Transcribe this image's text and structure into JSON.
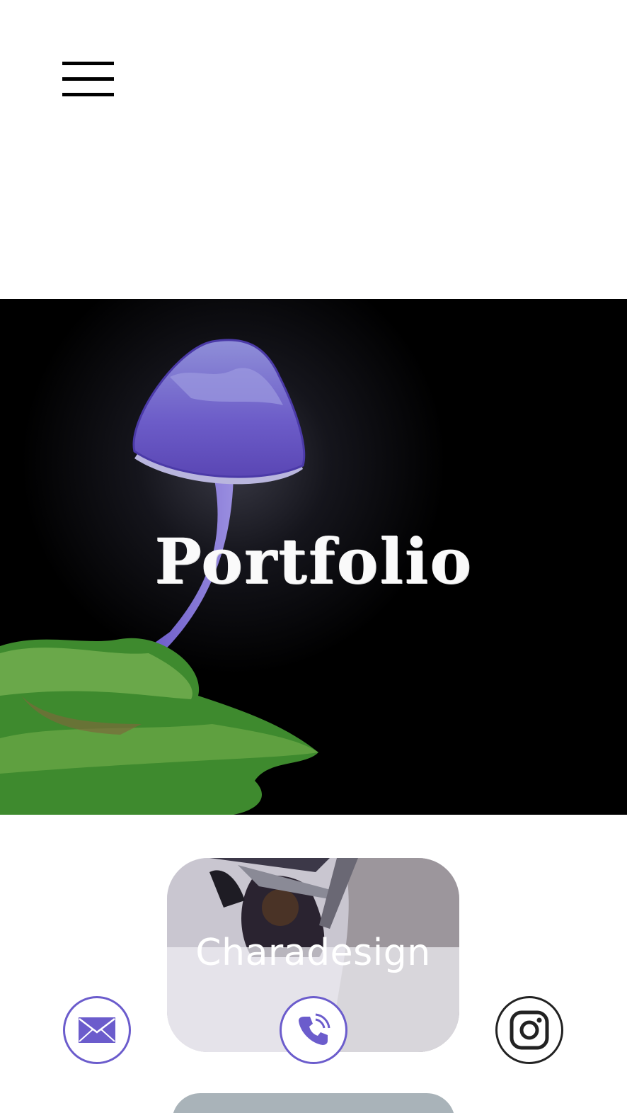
{
  "header": {
    "menu_icon": "hamburger-menu-icon"
  },
  "hero": {
    "title": "Portfolio",
    "background_color": "#000000"
  },
  "gallery": {
    "cards": [
      {
        "label": "Charadesign"
      }
    ]
  },
  "social": {
    "mail_icon": "mail-icon",
    "phone_icon": "phone-icon",
    "instagram_icon": "instagram-icon",
    "accent_color": "#6b5ccc"
  }
}
